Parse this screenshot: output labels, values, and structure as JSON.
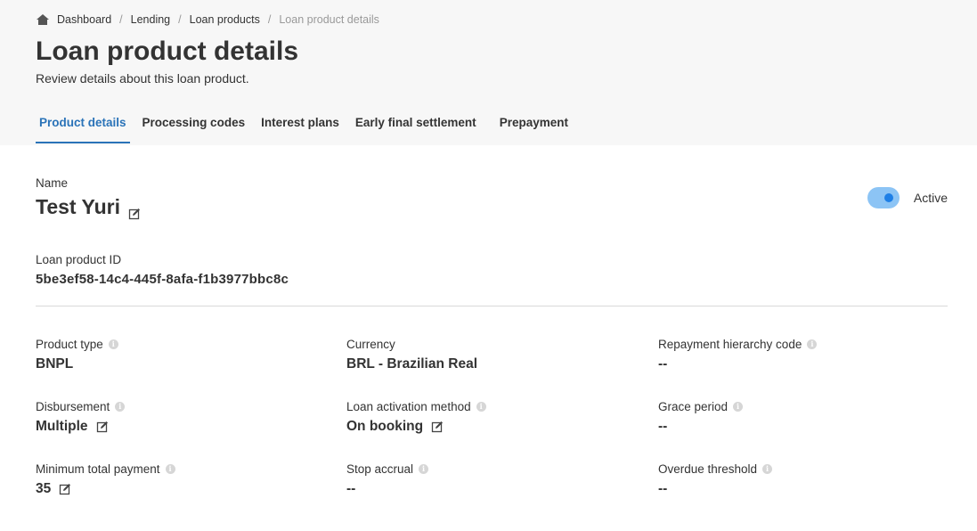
{
  "breadcrumb": {
    "home_icon": "home-icon",
    "items": [
      "Dashboard",
      "Lending",
      "Loan products",
      "Loan product details"
    ]
  },
  "page": {
    "title": "Loan product details",
    "subtitle": "Review details about this loan product."
  },
  "tabs": [
    {
      "label": "Product details",
      "active": true
    },
    {
      "label": "Processing codes",
      "active": false
    },
    {
      "label": "Interest plans",
      "active": false
    },
    {
      "label": "Early final settlement",
      "active": false
    },
    {
      "label": "Prepayment",
      "active": false
    }
  ],
  "product": {
    "name_label": "Name",
    "name_value": "Test Yuri",
    "status_label": "Active",
    "status_on": true,
    "id_label": "Loan product ID",
    "id_value": "5be3ef58-14c4-445f-8afa-f1b3977bbc8c"
  },
  "fields": {
    "product_type": {
      "label": "Product type",
      "value": "BNPL"
    },
    "currency": {
      "label": "Currency",
      "value": "BRL - Brazilian Real"
    },
    "repayment_hierarchy_code": {
      "label": "Repayment hierarchy code",
      "value": "--"
    },
    "disbursement": {
      "label": "Disbursement",
      "value": "Multiple"
    },
    "loan_activation_method": {
      "label": "Loan activation method",
      "value": "On booking"
    },
    "grace_period": {
      "label": "Grace period",
      "value": "--"
    },
    "minimum_total_payment": {
      "label": "Minimum total payment",
      "value": "35"
    },
    "stop_accrual": {
      "label": "Stop accrual",
      "value": "--"
    },
    "overdue_threshold": {
      "label": "Overdue threshold",
      "value": "--"
    }
  },
  "colors": {
    "accent": "#2a73b8",
    "toggle_track": "#8cc4f5",
    "toggle_knob": "#1e7fe6",
    "header_bg": "#f7f7f7"
  }
}
